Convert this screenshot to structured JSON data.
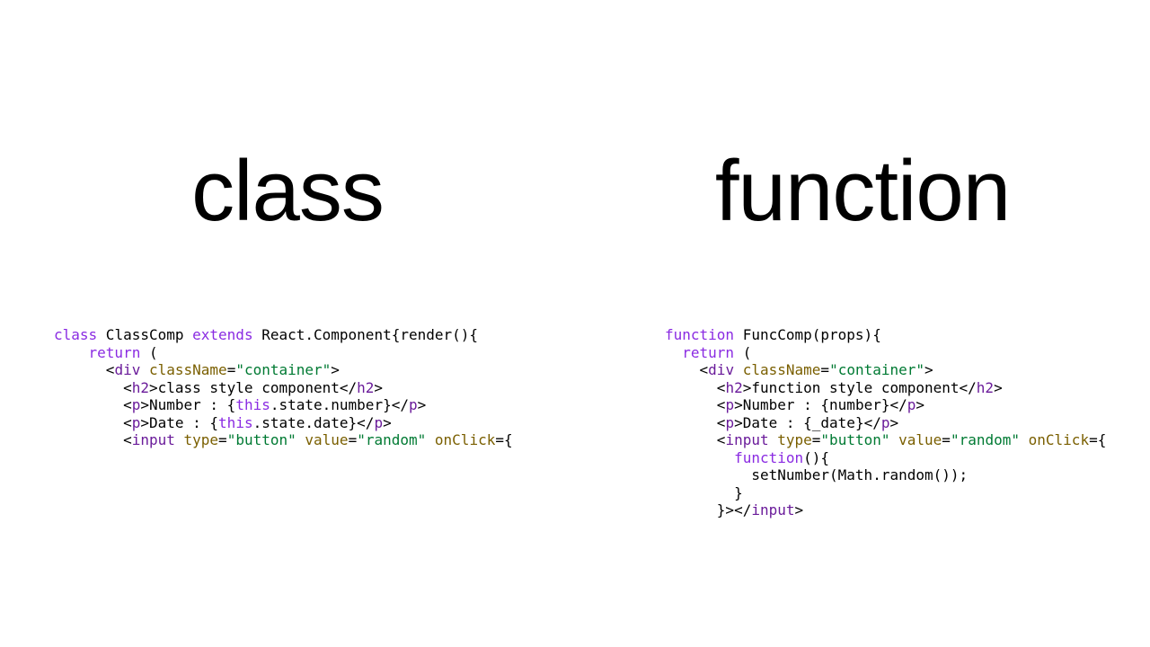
{
  "left": {
    "heading": "class",
    "tokens": [
      [
        [
          "kw",
          "class"
        ],
        [
          "",
          " ClassComp "
        ],
        [
          "kw",
          "extends"
        ],
        [
          "",
          " React.Component{render(){"
        ]
      ],
      [
        [
          "",
          "    "
        ],
        [
          "kw",
          "return"
        ],
        [
          "",
          " ("
        ]
      ],
      [
        [
          "",
          "      <"
        ],
        [
          "el",
          "div"
        ],
        [
          "",
          " "
        ],
        [
          "attr",
          "className"
        ],
        [
          "",
          "="
        ],
        [
          "str",
          "\"container\""
        ],
        [
          "",
          ">"
        ]
      ],
      [
        [
          "",
          "        <"
        ],
        [
          "el",
          "h2"
        ],
        [
          "",
          ">class style component</"
        ],
        [
          "el",
          "h2"
        ],
        [
          "",
          ">"
        ]
      ],
      [
        [
          "",
          "        <"
        ],
        [
          "el",
          "p"
        ],
        [
          "",
          ">Number : {"
        ],
        [
          "kw",
          "this"
        ],
        [
          "",
          ".state.number}</"
        ],
        [
          "el",
          "p"
        ],
        [
          "",
          ">"
        ]
      ],
      [
        [
          "",
          "        <"
        ],
        [
          "el",
          "p"
        ],
        [
          "",
          ">Date : {"
        ],
        [
          "kw",
          "this"
        ],
        [
          "",
          ".state.date}</"
        ],
        [
          "el",
          "p"
        ],
        [
          "",
          ">"
        ]
      ],
      [
        [
          "",
          "        <"
        ],
        [
          "el",
          "input"
        ],
        [
          "",
          " "
        ],
        [
          "attr",
          "type"
        ],
        [
          "",
          "="
        ],
        [
          "str",
          "\"button\""
        ],
        [
          "",
          " "
        ],
        [
          "attr",
          "value"
        ],
        [
          "",
          "="
        ],
        [
          "str",
          "\"random\""
        ],
        [
          "",
          " "
        ],
        [
          "attr",
          "onClick"
        ],
        [
          "",
          "={"
        ]
      ]
    ]
  },
  "right": {
    "heading": "function",
    "tokens": [
      [
        [
          "kw",
          "function"
        ],
        [
          "",
          " FuncComp(props){"
        ]
      ],
      [
        [
          "",
          "  "
        ],
        [
          "kw",
          "return"
        ],
        [
          "",
          " ("
        ]
      ],
      [
        [
          "",
          "    <"
        ],
        [
          "el",
          "div"
        ],
        [
          "",
          " "
        ],
        [
          "attr",
          "className"
        ],
        [
          "",
          "="
        ],
        [
          "str",
          "\"container\""
        ],
        [
          "",
          ">"
        ]
      ],
      [
        [
          "",
          "      <"
        ],
        [
          "el",
          "h2"
        ],
        [
          "",
          ">function style component</"
        ],
        [
          "el",
          "h2"
        ],
        [
          "",
          ">"
        ]
      ],
      [
        [
          "",
          "      <"
        ],
        [
          "el",
          "p"
        ],
        [
          "",
          ">Number : {number}</"
        ],
        [
          "el",
          "p"
        ],
        [
          "",
          ">"
        ]
      ],
      [
        [
          "",
          "      <"
        ],
        [
          "el",
          "p"
        ],
        [
          "",
          ">Date : {_date}</"
        ],
        [
          "el",
          "p"
        ],
        [
          "",
          ">"
        ]
      ],
      [
        [
          "",
          "      <"
        ],
        [
          "el",
          "input"
        ],
        [
          "",
          " "
        ],
        [
          "attr",
          "type"
        ],
        [
          "",
          "="
        ],
        [
          "str",
          "\"button\""
        ],
        [
          "",
          " "
        ],
        [
          "attr",
          "value"
        ],
        [
          "",
          "="
        ],
        [
          "str",
          "\"random\""
        ],
        [
          "",
          " "
        ],
        [
          "attr",
          "onClick"
        ],
        [
          "",
          "={"
        ]
      ],
      [
        [
          "",
          "        "
        ],
        [
          "kw",
          "function"
        ],
        [
          "",
          "(){"
        ]
      ],
      [
        [
          "",
          "          setNumber(Math.random());"
        ]
      ],
      [
        [
          "",
          "        }"
        ]
      ],
      [
        [
          "",
          "      }></"
        ],
        [
          "el",
          "input"
        ],
        [
          "",
          ">"
        ]
      ]
    ]
  }
}
